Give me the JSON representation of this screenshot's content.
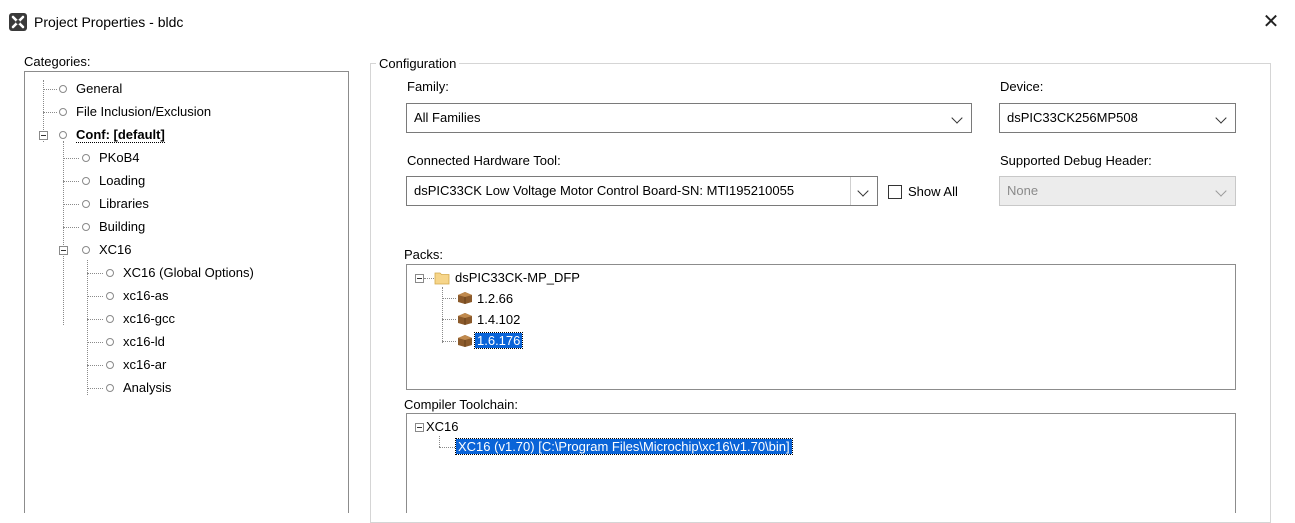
{
  "window": {
    "title": "Project Properties - bldc",
    "close_glyph": "✕"
  },
  "categories": {
    "label": "Categories:",
    "items": [
      {
        "label": "General"
      },
      {
        "label": "File Inclusion/Exclusion"
      },
      {
        "label": "Conf: [default]"
      },
      {
        "label": "PKoB4"
      },
      {
        "label": "Loading"
      },
      {
        "label": "Libraries"
      },
      {
        "label": "Building"
      },
      {
        "label": "XC16"
      },
      {
        "label": "XC16 (Global Options)"
      },
      {
        "label": "xc16-as"
      },
      {
        "label": "xc16-gcc"
      },
      {
        "label": "xc16-ld"
      },
      {
        "label": "xc16-ar"
      },
      {
        "label": "Analysis"
      }
    ]
  },
  "configuration": {
    "legend": "Configuration",
    "family": {
      "label": "Family:",
      "value": "All Families"
    },
    "device": {
      "label": "Device:",
      "value": "dsPIC33CK256MP508"
    },
    "hardware_tool": {
      "label": "Connected Hardware Tool:",
      "value": "dsPIC33CK Low Voltage Motor Control Board-SN: MTI195210055"
    },
    "show_all": {
      "label": "Show All",
      "checked": false
    },
    "debug_header": {
      "label": "Supported Debug Header:",
      "value": "None"
    },
    "packs": {
      "label": "Packs:",
      "root": "dsPIC33CK-MP_DFP",
      "versions": [
        "1.2.66",
        "1.4.102",
        "1.6.176"
      ],
      "selected": "1.6.176"
    },
    "toolchain": {
      "label": "Compiler Toolchain:",
      "root": "XC16",
      "item": "XC16 (v1.70) [C:\\Program Files\\Microchip\\xc16\\v1.70\\bin]"
    }
  }
}
